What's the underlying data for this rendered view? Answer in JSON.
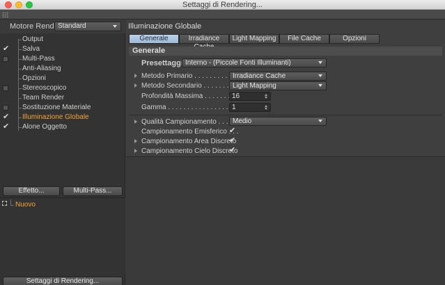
{
  "window": {
    "title": "Settaggi di Rendering..."
  },
  "left_panel": {
    "engine_label": "Motore Render",
    "engine_value": "Standard",
    "items": [
      {
        "label": "Output",
        "state": "none"
      },
      {
        "label": "Salva",
        "state": "checked"
      },
      {
        "label": "Multi-Pass",
        "state": "box"
      },
      {
        "label": "Anti-Aliasing",
        "state": "none"
      },
      {
        "label": "Opzioni",
        "state": "none"
      },
      {
        "label": "Stereoscopico",
        "state": "box"
      },
      {
        "label": "Team Render",
        "state": "none"
      },
      {
        "label": "Sostituzione Materiale",
        "state": "box"
      },
      {
        "label": "Illuminazione Globale",
        "state": "checked"
      },
      {
        "label": "Alone Oggetto",
        "state": "checked"
      }
    ],
    "effetto_button": "Effetto...",
    "multipass_button": "Multi-Pass...",
    "settings_item": "Nuovo",
    "render_settings_button": "Settaggi di Rendering..."
  },
  "right_panel": {
    "section_title": "Illuminazione Globale",
    "tabs": [
      {
        "label": "Generale",
        "active": true
      },
      {
        "label": "Irradiance Cache",
        "active": false
      },
      {
        "label": "Light Mapping",
        "active": false
      },
      {
        "label": "File Cache",
        "active": false
      },
      {
        "label": "Opzioni",
        "active": false
      }
    ],
    "group_header": "Generale",
    "preset_label": "Presettaggi",
    "preset_value": "Interno - (Piccole Fonti Illuminanti)",
    "primary_label": "Metodo Primario . . . . . . . . . . . .",
    "primary_value": "Irradiance Cache",
    "secondary_label": "Metodo Secondario . . . . . . . . . .",
    "secondary_value": "Light Mapping",
    "depth_label": "Profondità Massima . . . . . . . . . .",
    "depth_value": "16",
    "gamma_label": "Gamma . . . . . . . . . . . . . . . . . . .",
    "gamma_value": "1",
    "quality_label": "Qualità Campionamento . . . . . .",
    "quality_value": "Medio",
    "hemi_label": "Campionamento Emisferico . . .",
    "area_label": "Campionamento Area Discreto",
    "sky_label": "Campionamento Cielo Discreto",
    "check_mark": "✔"
  },
  "colors": {
    "active_accent": "#f4a534",
    "active_tab": "#a9c1de"
  }
}
